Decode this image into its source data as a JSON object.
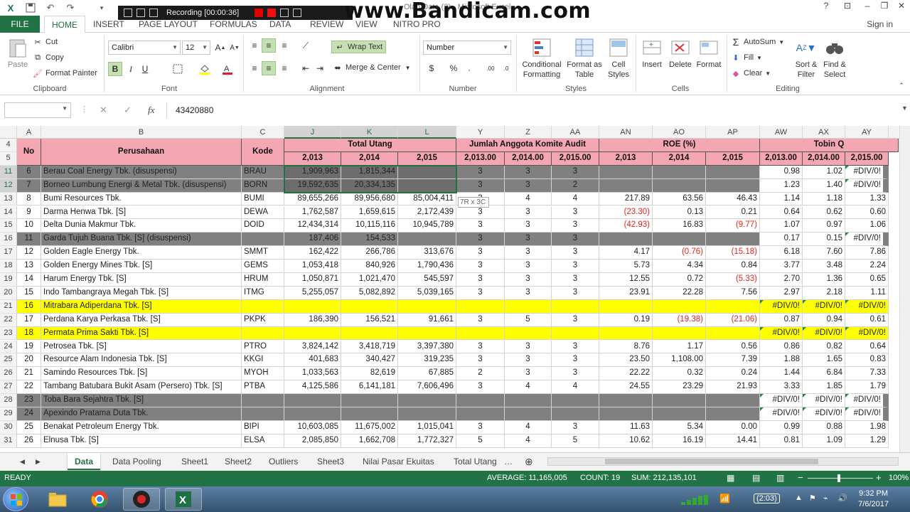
{
  "window": {
    "doc_title": "Olah Data (2) - Microsoft Excel",
    "recording_text": "Recording [00:00:36]",
    "watermark": "www.Bandicam.com",
    "signin": "Sign in"
  },
  "tabs": [
    "FILE",
    "HOME",
    "INSERT",
    "PAGE LAYOUT",
    "FORMULAS",
    "DATA",
    "REVIEW",
    "VIEW",
    "NITRO PRO"
  ],
  "ribbon": {
    "clipboard": {
      "paste": "Paste",
      "cut": "Cut",
      "copy": "Copy",
      "format_painter": "Format Painter",
      "label": "Clipboard"
    },
    "font": {
      "name": "Calibri",
      "size": "12",
      "label": "Font"
    },
    "alignment": {
      "wrap_text": "Wrap Text",
      "merge_center": "Merge & Center",
      "label": "Alignment"
    },
    "number": {
      "format": "Number",
      "label": "Number"
    },
    "styles": {
      "conditional": "Conditional Formatting",
      "format_table": "Format as Table",
      "cell_styles": "Cell Styles",
      "label": "Styles"
    },
    "cells": {
      "insert": "Insert",
      "delete": "Delete",
      "format": "Format",
      "label": "Cells"
    },
    "editing": {
      "autosum": "AutoSum",
      "fill": "Fill",
      "clear": "Clear",
      "sort_filter": "Sort & Filter",
      "find_select": "Find & Select",
      "label": "Editing"
    }
  },
  "formula_bar": {
    "fx": "fx",
    "value": "43420880"
  },
  "columns": [
    "A",
    "B",
    "C",
    "J",
    "K",
    "L",
    "Y",
    "Z",
    "AA",
    "AN",
    "AO",
    "AP",
    "AW",
    "AX",
    "AY"
  ],
  "header": {
    "row4": "4",
    "row5": "5",
    "no": "No",
    "perusahaan": "Perusahaan",
    "kode": "Kode",
    "total_utang": "Total Utang",
    "komite": "Jumlah Anggota Komite Audit",
    "roe": "ROE (%)",
    "tobin": "Tobin Q",
    "years_a": [
      "2,013",
      "2,014",
      "2,015"
    ],
    "years_b": [
      "2,013.00",
      "2,014.00",
      "2,015.00"
    ]
  },
  "rows": [
    {
      "r": "11",
      "style": "sel",
      "cells": [
        "6",
        "Berau Coal Energy Tbk. (disuspensi)",
        "BRAU",
        "1,909,963",
        "1,815,344",
        "",
        "3",
        "3",
        "3",
        "",
        "",
        "",
        "0.98",
        "1.02",
        "#DIV/0!"
      ]
    },
    {
      "r": "12",
      "style": "sel",
      "cells": [
        "7",
        "Borneo Lumbung Energi & Metal Tbk. (disuspensi)",
        "BORN",
        "19,592,635",
        "20,334,135",
        "",
        "3",
        "3",
        "2",
        "",
        "",
        "",
        "1.23",
        "1.40",
        "#DIV/0!"
      ]
    },
    {
      "r": "13",
      "style": "",
      "cells": [
        "8",
        "Bumi Resources Tbk.",
        "BUMI",
        "89,655,266",
        "89,956,680",
        "85,004,411",
        "3",
        "4",
        "4",
        "217.89",
        "63.56",
        "46.43",
        "1.14",
        "1.18",
        "1.33"
      ]
    },
    {
      "r": "14",
      "style": "",
      "cells": [
        "9",
        "Darma Henwa Tbk. [S]",
        "DEWA",
        "1,762,587",
        "1,659,615",
        "2,172,439",
        "3",
        "3",
        "3",
        "(23.30)",
        "0.13",
        "0.21",
        "0.64",
        "0.62",
        "0.60"
      ]
    },
    {
      "r": "15",
      "style": "",
      "cells": [
        "10",
        "Delta Dunia Makmur Tbk.",
        "DOID",
        "12,434,314",
        "10,115,116",
        "10,945,789",
        "3",
        "3",
        "3",
        "(42.93)",
        "16.83",
        "(9.77)",
        "1.07",
        "0.97",
        "1.06"
      ]
    },
    {
      "r": "16",
      "style": "grey",
      "cells": [
        "11",
        "Garda Tujuh Buana Tbk. [S] (disuspensi)",
        "",
        "187,406",
        "154,533",
        "",
        "3",
        "3",
        "3",
        "",
        "",
        "",
        "0.17",
        "0.15",
        "#DIV/0!"
      ]
    },
    {
      "r": "17",
      "style": "",
      "cells": [
        "12",
        "Golden Eagle Energy Tbk.",
        "SMMT",
        "162,422",
        "266,786",
        "313,676",
        "3",
        "3",
        "3",
        "4.17",
        "(0.76)",
        "(15.18)",
        "6.18",
        "7.60",
        "7.86"
      ]
    },
    {
      "r": "18",
      "style": "",
      "cells": [
        "13",
        "Golden Energy Mines Tbk. [S]",
        "GEMS",
        "1,053,418",
        "840,926",
        "1,790,436",
        "3",
        "3",
        "3",
        "5.73",
        "4.34",
        "0.84",
        "3.77",
        "3.48",
        "2.24"
      ]
    },
    {
      "r": "19",
      "style": "",
      "cells": [
        "14",
        "Harum Energy Tbk. [S]",
        "HRUM",
        "1,050,871",
        "1,021,470",
        "545,597",
        "3",
        "3",
        "3",
        "12.55",
        "0.72",
        "(5.33)",
        "2.70",
        "1.36",
        "0.65"
      ]
    },
    {
      "r": "20",
      "style": "",
      "cells": [
        "15",
        "Indo Tambangraya Megah Tbk. [S]",
        "ITMG",
        "5,255,057",
        "5,082,892",
        "5,039,165",
        "3",
        "3",
        "3",
        "23.91",
        "22.28",
        "7.56",
        "2.97",
        "2.18",
        "1.11"
      ]
    },
    {
      "r": "21",
      "style": "yellow",
      "cells": [
        "16",
        "Mitrabara Adiperdana Tbk. [S]",
        "",
        "",
        "",
        "",
        "",
        "",
        "",
        "",
        "",
        "",
        "#DIV/0!",
        "#DIV/0!",
        "#DIV/0!"
      ]
    },
    {
      "r": "22",
      "style": "",
      "cells": [
        "17",
        "Perdana Karya Perkasa Tbk. [S]",
        "PKPK",
        "186,390",
        "156,521",
        "91,661",
        "3",
        "5",
        "3",
        "0.19",
        "(19.38)",
        "(21.06)",
        "0.87",
        "0.94",
        "0.61"
      ]
    },
    {
      "r": "23",
      "style": "yellow",
      "cells": [
        "18",
        "Permata Prima Sakti Tbk. [S]",
        "",
        "",
        "",
        "",
        "",
        "",
        "",
        "",
        "",
        "",
        "#DIV/0!",
        "#DIV/0!",
        "#DIV/0!"
      ]
    },
    {
      "r": "24",
      "style": "",
      "cells": [
        "19",
        "Petrosea Tbk. [S]",
        "PTRO",
        "3,824,142",
        "3,418,719",
        "3,397,380",
        "3",
        "3",
        "3",
        "8.76",
        "1.17",
        "0.56",
        "0.86",
        "0.82",
        "0.64"
      ]
    },
    {
      "r": "25",
      "style": "",
      "cells": [
        "20",
        "Resource Alam Indonesia Tbk. [S]",
        "KKGI",
        "401,683",
        "340,427",
        "319,235",
        "3",
        "3",
        "3",
        "23.50",
        "1,108.00",
        "7.39",
        "1.88",
        "1.65",
        "0.83"
      ]
    },
    {
      "r": "26",
      "style": "",
      "cells": [
        "21",
        "Samindo Resources Tbk. [S]",
        "MYOH",
        "1,033,563",
        "82,619",
        "67,885",
        "2",
        "3",
        "3",
        "22.22",
        "0.32",
        "0.24",
        "1.44",
        "6.84",
        "7.33"
      ]
    },
    {
      "r": "27",
      "style": "",
      "cells": [
        "22",
        "Tambang Batubara Bukit Asam (Persero) Tbk. [S]",
        "PTBA",
        "4,125,586",
        "6,141,181",
        "7,606,496",
        "3",
        "4",
        "4",
        "24.55",
        "23.29",
        "21.93",
        "3.33",
        "1.85",
        "1.79"
      ]
    },
    {
      "r": "28",
      "style": "grey",
      "cells": [
        "23",
        "Toba Bara Sejahtra Tbk. [S]",
        "",
        "",
        "",
        "",
        "",
        "",
        "",
        "",
        "",
        "",
        "#DIV/0!",
        "#DIV/0!",
        "#DIV/0!"
      ]
    },
    {
      "r": "29",
      "style": "grey",
      "cells": [
        "24",
        "Apexindo Pratama Duta Tbk.",
        "",
        "",
        "",
        "",
        "",
        "",
        "",
        "",
        "",
        "",
        "#DIV/0!",
        "#DIV/0!",
        "#DIV/0!"
      ]
    },
    {
      "r": "30",
      "style": "",
      "cells": [
        "25",
        "Benakat Petroleum Energy Tbk.",
        "BIPI",
        "10,603,085",
        "11,675,002",
        "1,015,041",
        "3",
        "4",
        "3",
        "11.63",
        "5.34",
        "0.00",
        "0.99",
        "0.88",
        "1.98"
      ]
    },
    {
      "r": "31",
      "style": "",
      "cells": [
        "26",
        "Elnusa Tbk. [S]",
        "ELSA",
        "2,085,850",
        "1,662,708",
        "1,772,327",
        "5",
        "4",
        "5",
        "10.62",
        "16.19",
        "14.41",
        "0.81",
        "1.09",
        "1.29"
      ]
    }
  ],
  "tooltip": "7R x 3C",
  "sheets": [
    "Data",
    "Data Pooling",
    "Sheet1",
    "Sheet2",
    "Outliers",
    "Sheet3",
    "Nilai Pasar Ekuitas",
    "Total Utang"
  ],
  "status": {
    "ready": "READY",
    "average": "AVERAGE: 11,165,005",
    "count": "COUNT: 19",
    "sum": "SUM: 212,135,101",
    "zoom": "100%"
  },
  "taskbar": {
    "time": "9:32 PM",
    "date": "7/6/2017",
    "battery": "(2:03)"
  }
}
